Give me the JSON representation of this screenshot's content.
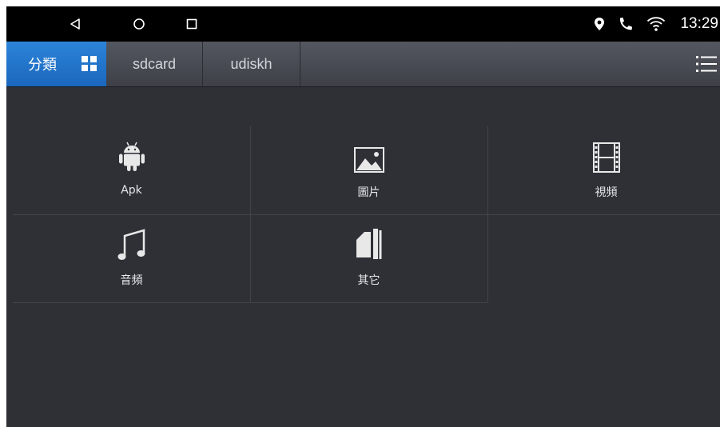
{
  "statusbar": {
    "nav_icons": [
      "back-triangle-icon",
      "home-circle-icon",
      "recents-square-icon"
    ],
    "status_icons": [
      "location-pin-icon",
      "phone-call-icon",
      "wifi-icon"
    ],
    "time": "13:29"
  },
  "tabs": {
    "category_label": "分類",
    "sdcard_label": "sdcard",
    "udisk_label": "udiskh",
    "active_color": "#1f73c9"
  },
  "categories": [
    {
      "label": "Apk",
      "icon": "android-icon"
    },
    {
      "label": "圖片",
      "icon": "image-icon"
    },
    {
      "label": "視頻",
      "icon": "film-icon"
    },
    {
      "label": "音頻",
      "icon": "music-note-icon"
    },
    {
      "label": "其它",
      "icon": "documents-icon"
    }
  ],
  "colors": {
    "background": "#2e3036",
    "statusbar": "#000000",
    "accent": "#1f73c9"
  }
}
